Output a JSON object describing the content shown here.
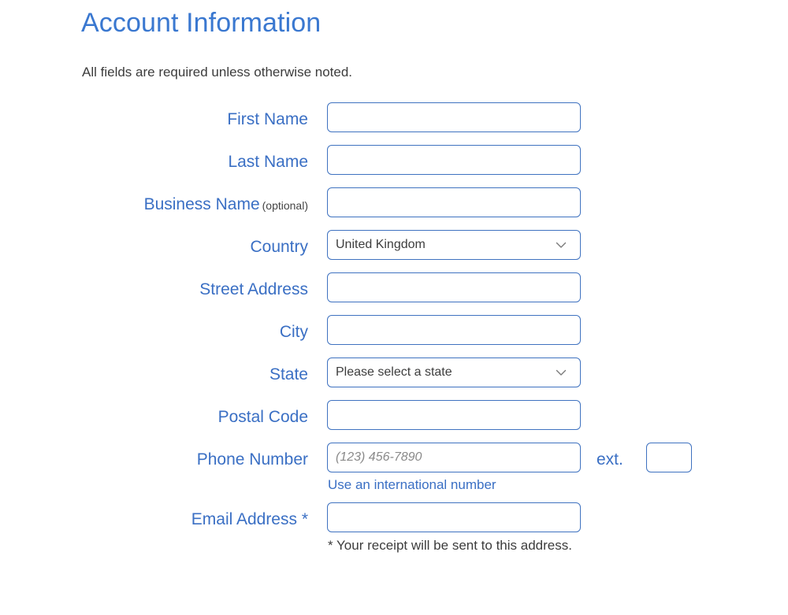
{
  "header": {
    "title": "Account Information",
    "subtitle": "All fields are required unless otherwise noted."
  },
  "form": {
    "first_name": {
      "label": "First Name",
      "value": "",
      "placeholder": ""
    },
    "last_name": {
      "label": "Last Name",
      "value": "",
      "placeholder": ""
    },
    "business_name": {
      "label": "Business Name",
      "optional_note": "(optional)",
      "value": "",
      "placeholder": ""
    },
    "country": {
      "label": "Country",
      "selected": "United Kingdom",
      "chevron_icon": "chevron-down-icon"
    },
    "street_address": {
      "label": "Street Address",
      "value": "",
      "placeholder": ""
    },
    "city": {
      "label": "City",
      "value": "",
      "placeholder": ""
    },
    "state": {
      "label": "State",
      "selected": "Please select a state",
      "chevron_icon": "chevron-down-icon"
    },
    "postal_code": {
      "label": "Postal Code",
      "value": "",
      "placeholder": ""
    },
    "phone": {
      "label": "Phone Number",
      "value": "",
      "placeholder": "(123) 456-7890",
      "ext_label": "ext.",
      "ext_value": "",
      "ext_placeholder": "",
      "international_link": "Use an international number"
    },
    "email": {
      "label": "Email Address *",
      "value": "",
      "placeholder": "",
      "note": "* Your receipt will be sent to this address."
    }
  },
  "colors": {
    "title_blue": "#3a78d0",
    "label_blue": "#3a6fc4",
    "border_blue": "#3f72c0",
    "body_text": "#3c3c3c",
    "placeholder_gray": "#8a8a8a",
    "chevron_gray": "#7a7a7a",
    "background": "#ffffff"
  }
}
